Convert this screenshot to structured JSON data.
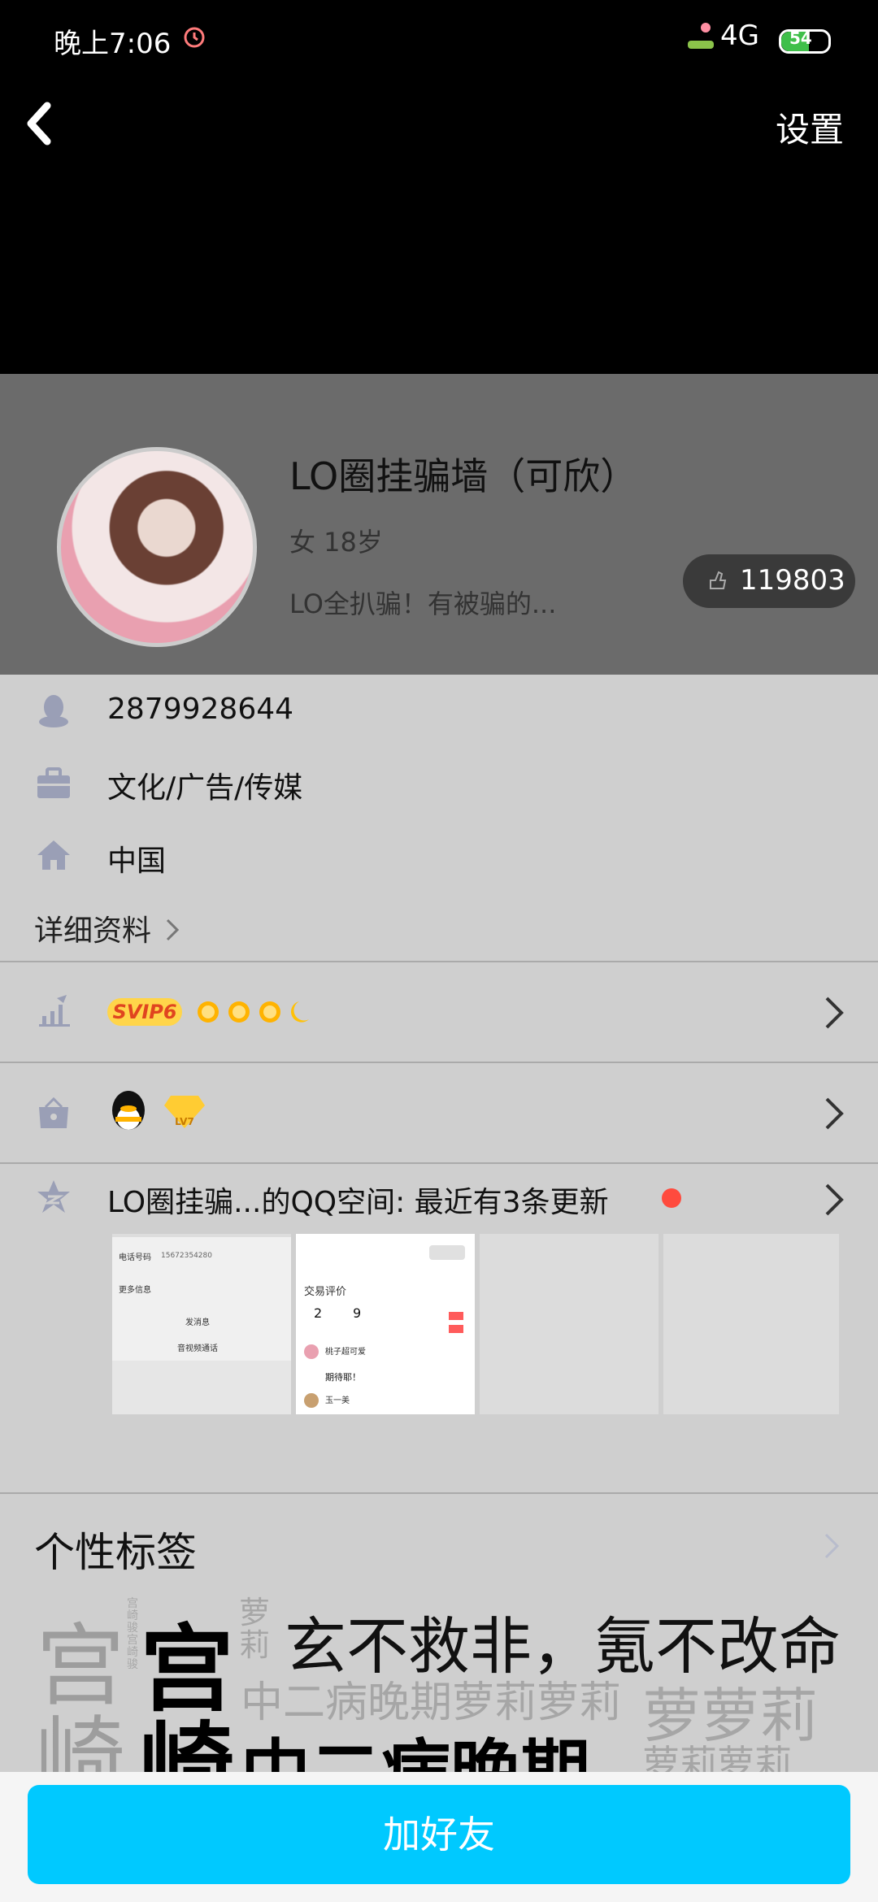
{
  "status_bar": {
    "time": "晚上7:06",
    "network": "4G",
    "battery": "54"
  },
  "header": {
    "settings_label": "设置"
  },
  "profile": {
    "name": "LO圈挂骗墙（可欣）",
    "gender_age": "女 18岁",
    "bio": "LO全扒骗！有被骗的...",
    "likes": "119803"
  },
  "info": {
    "qq": "2879928644",
    "industry": "文化/广告/传媒",
    "location": "中国",
    "detail_label": "详细资料"
  },
  "vip": {
    "badge": "SVIP6"
  },
  "qzone": {
    "label": "LO圈挂骗...的QQ空间: 最近有3条更新"
  },
  "tags": {
    "title": "个性标签",
    "words": [
      "宫",
      "宫",
      "崎",
      "崎",
      "萝莉",
      "玄不救非，氪不改命",
      "中二病晚期萝莉萝莉",
      "萝萝莉",
      "中二病晚期",
      "萝莉萝莉",
      "宫崎骏宫崎骏"
    ]
  },
  "bottom": {
    "add_friend_label": "加好友"
  },
  "thumbs": {
    "t1_phone_label": "电话号码",
    "t1_phone": "15672354280",
    "t1_more": "更多信息",
    "t1_msg": "发消息",
    "t1_video": "音视频通话",
    "t2_title": "交易评价",
    "t2_num1": "2",
    "t2_num2": "9",
    "t2_user1": "桃子超可爱",
    "t2_comment1": "期待耶！",
    "t2_user2": "玉一美"
  }
}
